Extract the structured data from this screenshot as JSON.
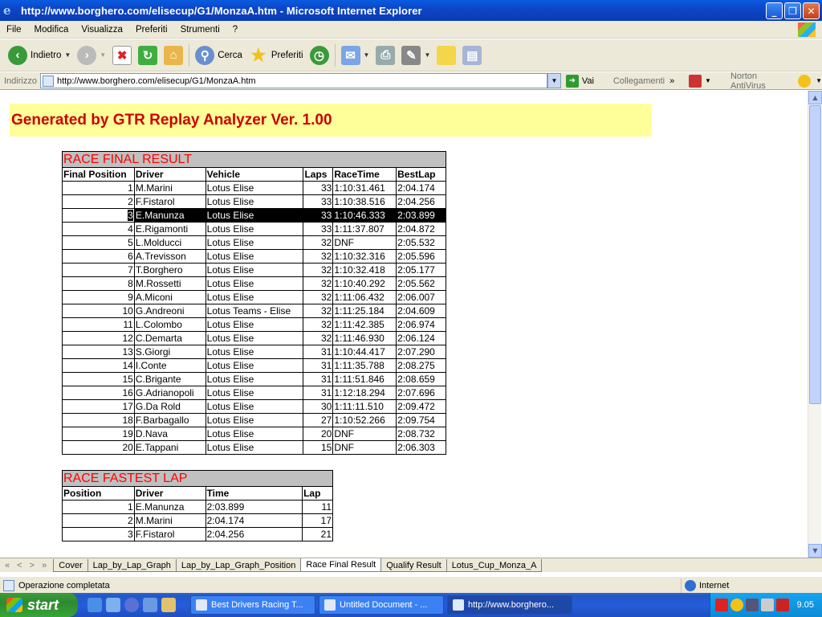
{
  "window": {
    "title": "http://www.borghero.com/elisecup/G1/MonzaA.htm - Microsoft Internet Explorer"
  },
  "menu": [
    "File",
    "Modifica",
    "Visualizza",
    "Preferiti",
    "Strumenti",
    "?"
  ],
  "toolbar": {
    "back_label": "Indietro",
    "search_label": "Cerca",
    "favorites_label": "Preferiti"
  },
  "address": {
    "label": "Indirizzo",
    "url": "http://www.borghero.com/elisecup/G1/MonzaA.htm",
    "go_label": "Vai",
    "links_label": "Collegamenti",
    "antivirus_label": "Norton AntiVirus"
  },
  "page": {
    "banner": "Generated by GTR Replay Analyzer Ver. 1.00",
    "race_result": {
      "caption": "RACE FINAL RESULT",
      "headers": [
        "Final Position",
        "Driver",
        "Vehicle",
        "Laps",
        "RaceTime",
        "BestLap"
      ],
      "rows": [
        [
          "1",
          "M.Marini",
          "Lotus Elise",
          "33",
          "1:10:31.461",
          "2:04.174"
        ],
        [
          "2",
          "F.Fistarol",
          "Lotus Elise",
          "33",
          "1:10:38.516",
          "2:04.256"
        ],
        [
          "3",
          "E.Manunza",
          "Lotus Elise",
          "33",
          "1:10:46.333",
          "2:03.899"
        ],
        [
          "4",
          "E.Rigamonti",
          "Lotus Elise",
          "33",
          "1:11:37.807",
          "2:04.872"
        ],
        [
          "5",
          "L.Molducci",
          "Lotus Elise",
          "32",
          "DNF",
          "2:05.532"
        ],
        [
          "6",
          "A.Trevisson",
          "Lotus Elise",
          "32",
          "1:10:32.316",
          "2:05.596"
        ],
        [
          "7",
          "T.Borghero",
          "Lotus Elise",
          "32",
          "1:10:32.418",
          "2:05.177"
        ],
        [
          "8",
          "M.Rossetti",
          "Lotus Elise",
          "32",
          "1:10:40.292",
          "2:05.562"
        ],
        [
          "9",
          "A.Miconi",
          "Lotus Elise",
          "32",
          "1:11:06.432",
          "2:06.007"
        ],
        [
          "10",
          "G.Andreoni",
          "Lotus Teams - Elise",
          "32",
          "1:11:25.184",
          "2:04.609"
        ],
        [
          "11",
          "L.Colombo",
          "Lotus Elise",
          "32",
          "1:11:42.385",
          "2:06.974"
        ],
        [
          "12",
          "C.Demarta",
          "Lotus Elise",
          "32",
          "1:11:46.930",
          "2:06.124"
        ],
        [
          "13",
          "S.Giorgi",
          "Lotus Elise",
          "31",
          "1:10:44.417",
          "2:07.290"
        ],
        [
          "14",
          "I.Conte",
          "Lotus Elise",
          "31",
          "1:11:35.788",
          "2:08.275"
        ],
        [
          "15",
          "C.Brigante",
          "Lotus Elise",
          "31",
          "1:11:51.846",
          "2:08.659"
        ],
        [
          "16",
          "G.Adrianopoli",
          "Lotus Elise",
          "31",
          "1:12:18.294",
          "2:07.696"
        ],
        [
          "17",
          "G.Da Rold",
          "Lotus Elise",
          "30",
          "1:11:11.510",
          "2:09.472"
        ],
        [
          "18",
          "F.Barbagallo",
          "Lotus Elise",
          "27",
          "1:10:52.266",
          "2:09.754"
        ],
        [
          "19",
          "D.Nava",
          "Lotus Elise",
          "20",
          "DNF",
          "2:08.732"
        ],
        [
          "20",
          "E.Tappani",
          "Lotus Elise",
          "15",
          "DNF",
          "2:06.303"
        ]
      ]
    },
    "fastest_lap": {
      "caption": "RACE FASTEST LAP",
      "headers": [
        "Position",
        "Driver",
        "Time",
        "Lap"
      ],
      "rows": [
        [
          "1",
          "E.Manunza",
          "2:03.899",
          "11"
        ],
        [
          "2",
          "M.Marini",
          "2:04.174",
          "17"
        ],
        [
          "3",
          "F.Fistarol",
          "2:04.256",
          "21"
        ]
      ]
    }
  },
  "sheet_tabs": {
    "nav": "« < > »",
    "tabs": [
      "Cover",
      "Lap_by_Lap_Graph",
      "Lap_by_Lap_Graph_Position",
      "Race Final Result",
      "Qualify Result",
      "Lotus_Cup_Monza_A"
    ],
    "active": "Race Final Result"
  },
  "status": {
    "text": "Operazione completata",
    "zone": "Internet"
  },
  "taskbar": {
    "start_label": "start",
    "tasks": [
      "Best Drivers Racing T...",
      "Untitled Document - ...",
      "http://www.borghero..."
    ],
    "clock": "9.05"
  }
}
